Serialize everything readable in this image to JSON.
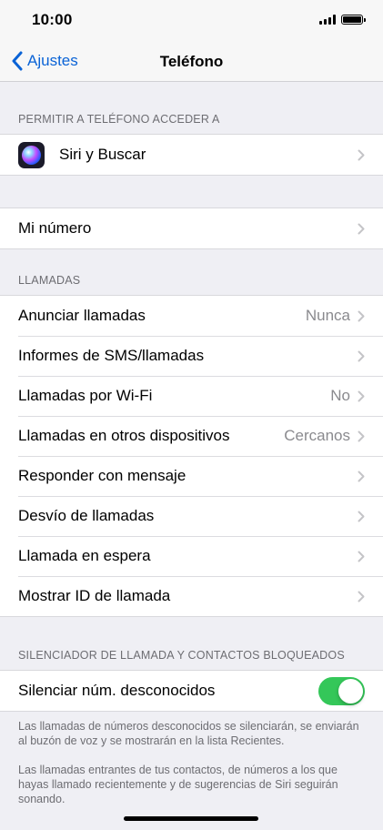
{
  "status_bar": {
    "time": "10:00"
  },
  "nav": {
    "back_label": "Ajustes",
    "title": "Teléfono"
  },
  "sections": {
    "allow": {
      "header": "PERMITIR A TELÉFONO ACCEDER A",
      "siri": {
        "label": "Siri y Buscar",
        "icon": "siri-icon"
      }
    },
    "my_number": {
      "label": "Mi número"
    },
    "calls": {
      "header": "LLAMADAS",
      "items": [
        {
          "label": "Anunciar llamadas",
          "value": "Nunca"
        },
        {
          "label": "Informes de SMS/llamadas",
          "value": ""
        },
        {
          "label": "Llamadas por Wi-Fi",
          "value": "No"
        },
        {
          "label": "Llamadas en otros dispositivos",
          "value": "Cercanos"
        },
        {
          "label": "Responder con mensaje",
          "value": ""
        },
        {
          "label": "Desvío de llamadas",
          "value": ""
        },
        {
          "label": "Llamada en espera",
          "value": ""
        },
        {
          "label": "Mostrar ID de llamada",
          "value": ""
        }
      ]
    },
    "silence": {
      "header": "SILENCIADOR DE LLAMADA Y CONTACTOS BLOQUEADOS",
      "toggle_label": "Silenciar núm. desconocidos",
      "toggle_on": true,
      "footer_1": "Las llamadas de números desconocidos se silenciarán, se enviarán al buzón de voz y se mostrarán en la lista Recientes.",
      "footer_2": "Las llamadas entrantes de tus contactos, de números a los que hayas llamado recientemente y de sugerencias de Siri seguirán sonando."
    }
  },
  "colors": {
    "accent": "#0a63d6",
    "toggle_on": "#34c759",
    "background": "#efeff4"
  }
}
